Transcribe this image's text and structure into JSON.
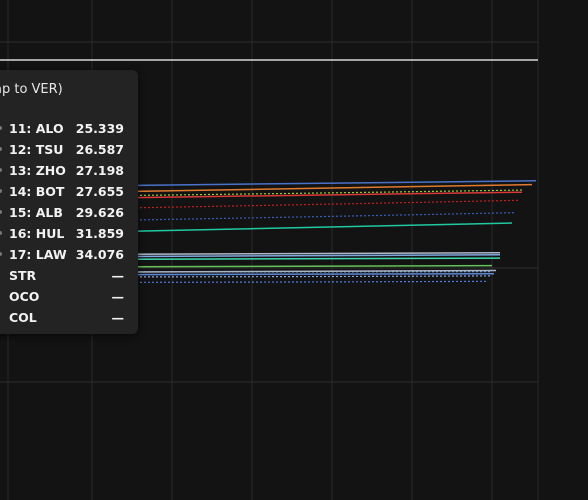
{
  "chart_data": {
    "type": "line",
    "title": "",
    "xlabel": "",
    "ylabel": "",
    "legend": "tooltip-left",
    "grid": true,
    "x_ticks": 9,
    "series": [
      {
        "name": "11: ALO",
        "color": "#4a72c8",
        "dash": "solid",
        "start": 25.339,
        "end": 24.2
      },
      {
        "name": "12: TSU",
        "color": "#e07a2f",
        "dash": "solid",
        "start": 26.587,
        "end": 24.9
      },
      {
        "name": "13: ZHO",
        "color": "#9acd32",
        "dash": "dotted",
        "start": 27.198,
        "end": 25.9
      },
      {
        "name": "14: BOT",
        "color": "#d83838",
        "dash": "solid",
        "start": 27.655,
        "end": 26.3
      },
      {
        "name": "15: ALB",
        "color": "#c02222",
        "dash": "dotted",
        "start": 29.626,
        "end": 27.8
      },
      {
        "name": "16: HUL",
        "color": "#3a5fb8",
        "dash": "dotted",
        "start": 31.859,
        "end": 30.1
      },
      {
        "name": "17: LAW",
        "color": "#20c9a0",
        "dash": "solid",
        "start": 34.076,
        "end": 32.0
      },
      {
        "name": "STR",
        "color": "#b0b8c8",
        "dash": "solid",
        "start": 37.9,
        "end": 37.5
      },
      {
        "name": "OCO",
        "color": "#7fa8e0",
        "dash": "solid",
        "start": 38.3,
        "end": 37.9
      },
      {
        "name": "COL",
        "color": "#3dd9b0",
        "dash": "solid",
        "start": 38.8,
        "end": 38.5
      },
      {
        "name": "",
        "color": "#63c35a",
        "dash": "solid",
        "start": 40.2,
        "end": 39.9
      },
      {
        "name": "",
        "color": "#6a8fd0",
        "dash": "dotted",
        "start": 41.0,
        "end": 41.0
      },
      {
        "name": "",
        "color": "#a9b4c4",
        "dash": "solid",
        "start": 41.2,
        "end": 40.8
      },
      {
        "name": "",
        "color": "#5b86d6",
        "dash": "solid",
        "start": 41.6,
        "end": 41.4
      },
      {
        "name": "",
        "color": "#8aa4d8",
        "dash": "dotted",
        "start": 42.0,
        "end": 41.8
      },
      {
        "name": "",
        "color": "#4f7ae0",
        "dash": "dotted",
        "start": 43.0,
        "end": 42.8
      }
    ]
  },
  "tooltip": {
    "title": "ap to VER)",
    "rows": [
      {
        "name": "11: ALO",
        "value": "25.339"
      },
      {
        "name": "12: TSU",
        "value": "26.587"
      },
      {
        "name": "13: ZHO",
        "value": "27.198"
      },
      {
        "name": "14: BOT",
        "value": "27.655"
      },
      {
        "name": "15: ALB",
        "value": "29.626"
      },
      {
        "name": "16: HUL",
        "value": "31.859"
      },
      {
        "name": "17: LAW",
        "value": "34.076"
      },
      {
        "name": "STR",
        "value": "—"
      },
      {
        "name": "OCO",
        "value": "—"
      },
      {
        "name": "COL",
        "value": "—"
      }
    ]
  }
}
